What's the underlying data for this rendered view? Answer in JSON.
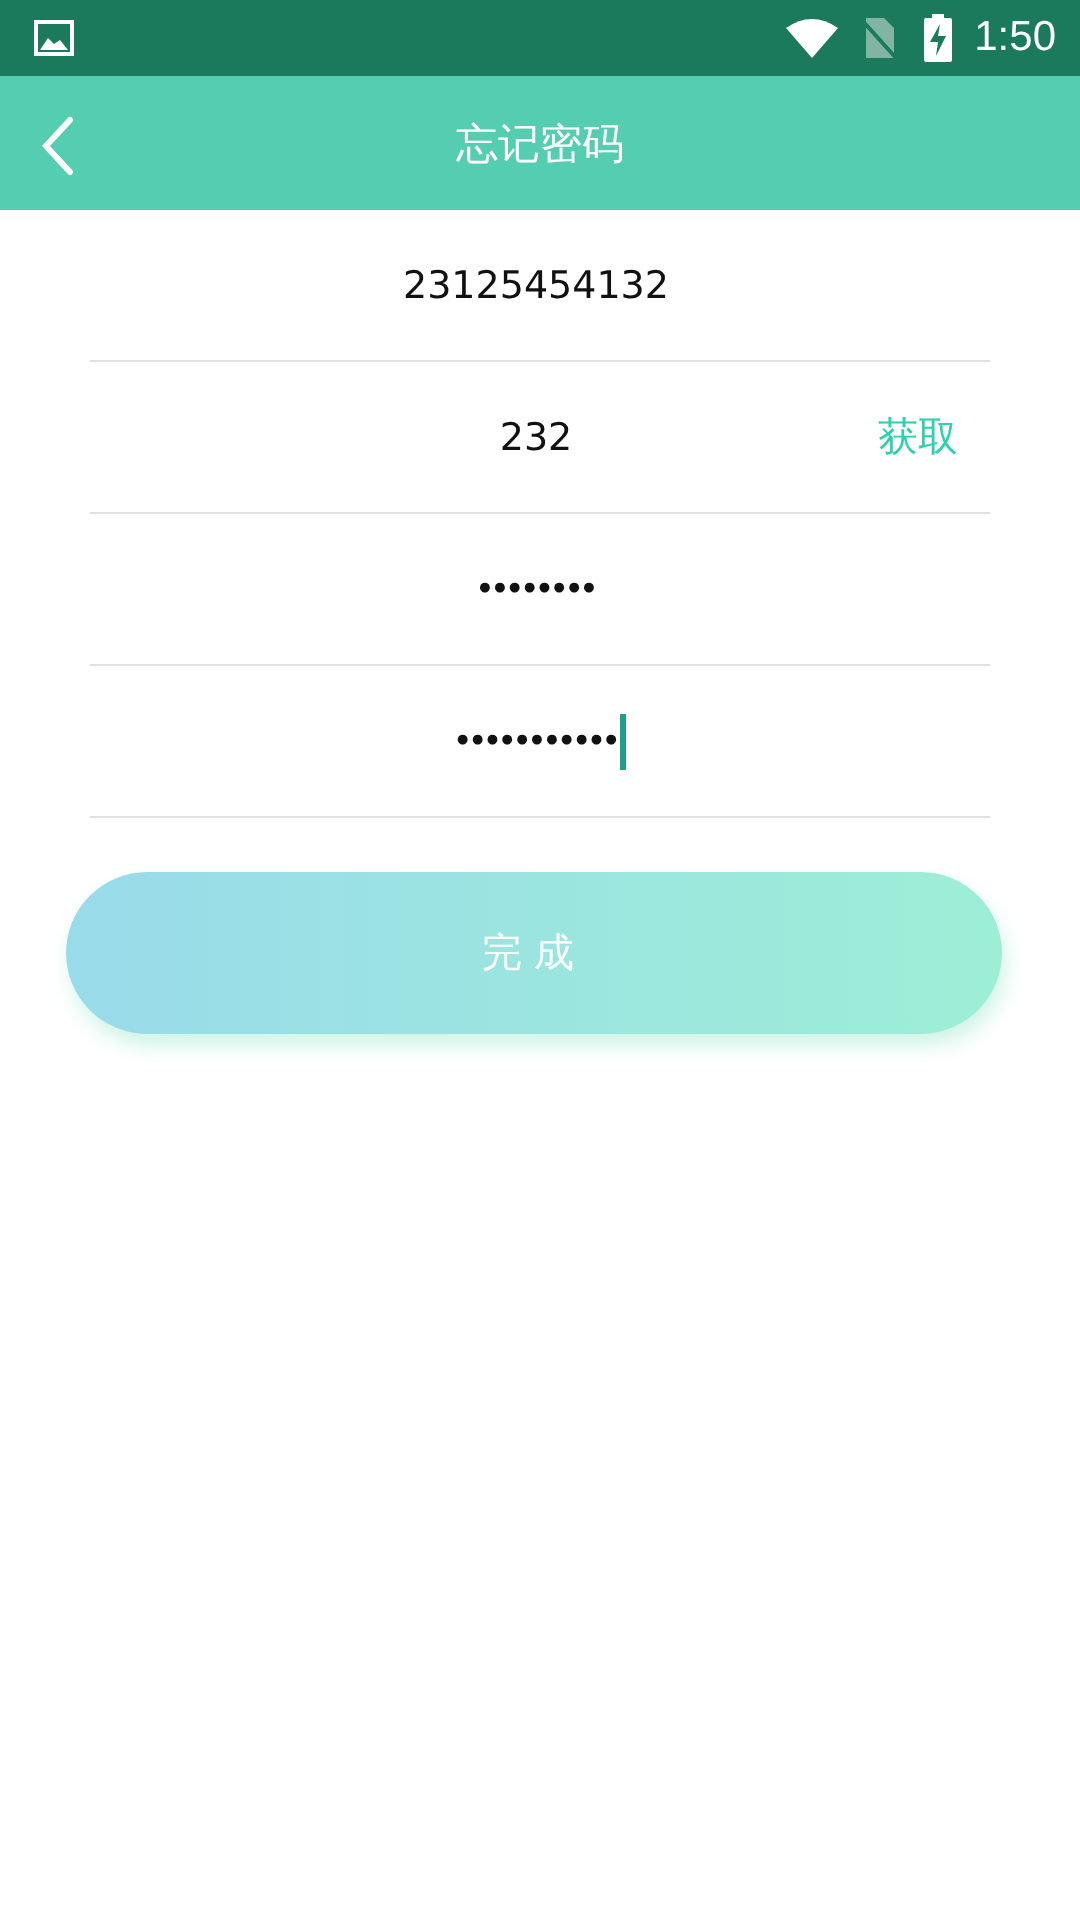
{
  "status_bar": {
    "time": "1:50"
  },
  "app_bar": {
    "title": "忘记密码"
  },
  "fields": [
    {
      "kind": "text",
      "value": "23125454132",
      "focused": false
    },
    {
      "kind": "code",
      "value": "232",
      "action": "获取",
      "focused": false
    },
    {
      "kind": "password",
      "value": "••••••••",
      "focused": false
    },
    {
      "kind": "password",
      "value": "•••••••••••",
      "focused": true
    }
  ],
  "submit": {
    "label": "完成"
  }
}
